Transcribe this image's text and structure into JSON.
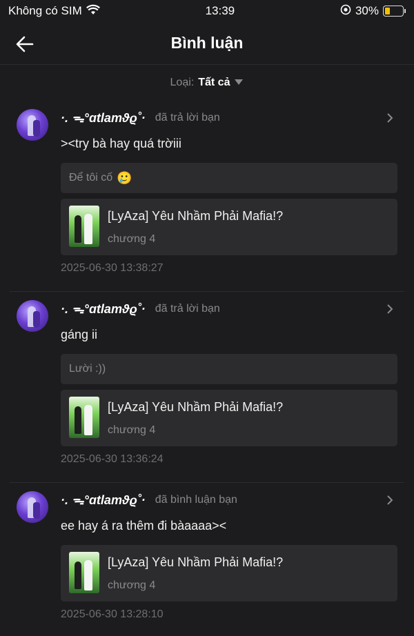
{
  "status": {
    "carrier": "Không có SIM",
    "time": "13:39",
    "battery": "30%",
    "battery_level": 0.3
  },
  "nav": {
    "title": "Bình luận"
  },
  "filter": {
    "label": "Loại:",
    "value": "Tất cả"
  },
  "comments": [
    {
      "username": "·.  ᯓ°ɑtlamϑϱ˚·",
      "action": "đã trả lời bạn",
      "text": "><try bà hay quá trờiii",
      "quote": "Để tôi cố",
      "quote_emoji": "🥲",
      "story_title": "[LyAza] Yêu Nhầm Phải Mafia!?",
      "story_chapter": "chương 4",
      "time": "2025-06-30 13:38:27"
    },
    {
      "username": "·.  ᯓ°ɑtlamϑϱ˚·",
      "action": "đã trả lời bạn",
      "text": "gáng ii",
      "quote": "Lười :))",
      "story_title": "[LyAza] Yêu Nhầm Phải Mafia!?",
      "story_chapter": "chương 4",
      "time": "2025-06-30 13:36:24"
    },
    {
      "username": "·.  ᯓ°ɑtlamϑϱ˚·",
      "action": "đã bình luận bạn",
      "text": "ee hay á ra thêm đi bàaaaa><",
      "story_title": "[LyAza] Yêu Nhầm Phải Mafia!?",
      "story_chapter": "chương 4",
      "time": "2025-06-30 13:28:10"
    }
  ]
}
